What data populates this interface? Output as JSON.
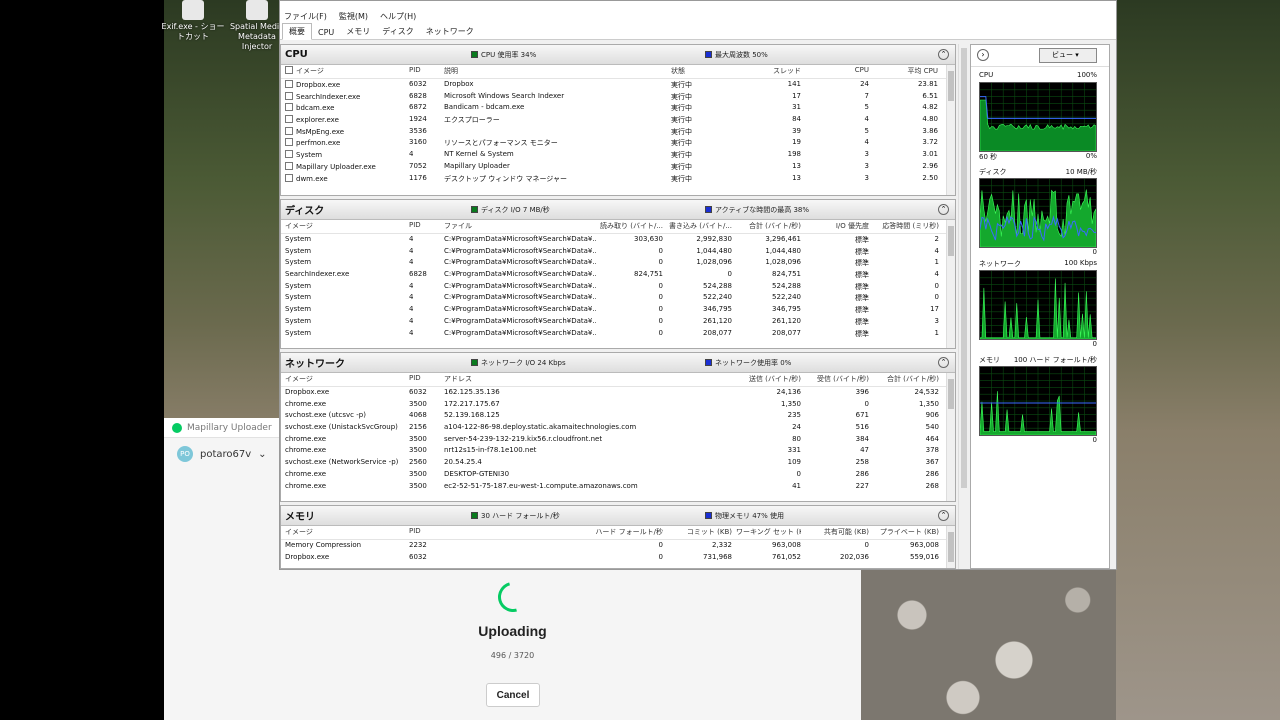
{
  "desktop": {
    "icons": [
      {
        "label": "Exif.exe - ショートカット"
      },
      {
        "label": "Spatial Media Metadata Injector"
      }
    ]
  },
  "mapillary": {
    "app_name": "Mapillary Uploader",
    "avatar_initials": "PO",
    "username": "potaro67v",
    "status": "Uploading",
    "progress": "496 / 3720",
    "cancel_label": "Cancel"
  },
  "monitor": {
    "menu": [
      "ファイル(F)",
      "監視(M)",
      "ヘルプ(H)"
    ],
    "tabs": [
      "概要",
      "CPU",
      "メモリ",
      "ディスク",
      "ネットワーク"
    ],
    "cpu": {
      "title": "CPU",
      "ind1": "CPU 使用率 34%",
      "ind2": "最大周波数 50%",
      "headers": [
        "イメージ",
        "PID",
        "説明",
        "状態",
        "スレッド",
        "CPU",
        "平均 CPU"
      ],
      "rows": [
        [
          "Dropbox.exe",
          "6032",
          "Dropbox",
          "実行中",
          "141",
          "24",
          "23.81"
        ],
        [
          "SearchIndexer.exe",
          "6828",
          "Microsoft Windows Search Indexer",
          "実行中",
          "17",
          "7",
          "6.51"
        ],
        [
          "bdcam.exe",
          "6872",
          "Bandicam - bdcam.exe",
          "実行中",
          "31",
          "5",
          "4.82"
        ],
        [
          "explorer.exe",
          "1924",
          "エクスプローラー",
          "実行中",
          "84",
          "4",
          "4.80"
        ],
        [
          "MsMpEng.exe",
          "3536",
          "",
          "実行中",
          "39",
          "5",
          "3.86"
        ],
        [
          "perfmon.exe",
          "3160",
          "リソースとパフォーマンス モニター",
          "実行中",
          "19",
          "4",
          "3.72"
        ],
        [
          "System",
          "4",
          "NT Kernel & System",
          "実行中",
          "198",
          "3",
          "3.01"
        ],
        [
          "Mapillary Uploader.exe",
          "7052",
          "Mapillary Uploader",
          "実行中",
          "13",
          "3",
          "2.96"
        ],
        [
          "dwm.exe",
          "1176",
          "デスクトップ ウィンドウ マネージャー",
          "実行中",
          "13",
          "3",
          "2.50"
        ]
      ]
    },
    "disk": {
      "title": "ディスク",
      "ind1": "ディスク I/O 7 MB/秒",
      "ind2": "アクティブな時間の最高 38%",
      "headers": [
        "イメージ",
        "PID",
        "ファイル",
        "読み取り (バイト/...",
        "書き込み (バイト/...",
        "合計 (バイト/秒)",
        "I/O 優先度",
        "応答時間 (ミリ秒)"
      ],
      "rows": [
        [
          "System",
          "4",
          "C:¥ProgramData¥Microsoft¥Search¥Data¥...",
          "303,630",
          "2,992,830",
          "3,296,461",
          "標準",
          "2"
        ],
        [
          "System",
          "4",
          "C:¥ProgramData¥Microsoft¥Search¥Data¥...",
          "0",
          "1,044,480",
          "1,044,480",
          "標準",
          "4"
        ],
        [
          "System",
          "4",
          "C:¥ProgramData¥Microsoft¥Search¥Data¥...",
          "0",
          "1,028,096",
          "1,028,096",
          "標準",
          "1"
        ],
        [
          "SearchIndexer.exe",
          "6828",
          "C:¥ProgramData¥Microsoft¥Search¥Data¥...",
          "824,751",
          "0",
          "824,751",
          "標準",
          "4"
        ],
        [
          "System",
          "4",
          "C:¥ProgramData¥Microsoft¥Search¥Data¥...",
          "0",
          "524,288",
          "524,288",
          "標準",
          "0"
        ],
        [
          "System",
          "4",
          "C:¥ProgramData¥Microsoft¥Search¥Data¥...",
          "0",
          "522,240",
          "522,240",
          "標準",
          "0"
        ],
        [
          "System",
          "4",
          "C:¥ProgramData¥Microsoft¥Search¥Data¥...",
          "0",
          "346,795",
          "346,795",
          "標準",
          "17"
        ],
        [
          "System",
          "4",
          "C:¥ProgramData¥Microsoft¥Search¥Data¥...",
          "0",
          "261,120",
          "261,120",
          "標準",
          "3"
        ],
        [
          "System",
          "4",
          "C:¥ProgramData¥Microsoft¥Search¥Data¥...",
          "0",
          "208,077",
          "208,077",
          "標準",
          "1"
        ]
      ]
    },
    "network": {
      "title": "ネットワーク",
      "ind1": "ネットワーク I/O 24 Kbps",
      "ind2": "ネットワーク使用率 0%",
      "headers": [
        "イメージ",
        "PID",
        "アドレス",
        "送信 (バイト/秒)",
        "受信 (バイト/秒)",
        "合計 (バイト/秒)"
      ],
      "rows": [
        [
          "Dropbox.exe",
          "6032",
          "162.125.35.136",
          "24,136",
          "396",
          "24,532"
        ],
        [
          "chrome.exe",
          "3500",
          "172.217.175.67",
          "1,350",
          "0",
          "1,350"
        ],
        [
          "svchost.exe (utcsvc -p)",
          "4068",
          "52.139.168.125",
          "235",
          "671",
          "906"
        ],
        [
          "svchost.exe (UnistackSvcGroup)",
          "2156",
          "a104-122-86-98.deploy.static.akamaitechnologies.com",
          "24",
          "516",
          "540"
        ],
        [
          "chrome.exe",
          "3500",
          "server-54-239-132-219.kix56.r.cloudfront.net",
          "80",
          "384",
          "464"
        ],
        [
          "chrome.exe",
          "3500",
          "nrt12s15-in-f78.1e100.net",
          "331",
          "47",
          "378"
        ],
        [
          "svchost.exe (NetworkService -p)",
          "2560",
          "20.54.25.4",
          "109",
          "258",
          "367"
        ],
        [
          "chrome.exe",
          "3500",
          "DESKTOP-GTENI30",
          "0",
          "286",
          "286"
        ],
        [
          "chrome.exe",
          "3500",
          "ec2-52-51-75-187.eu-west-1.compute.amazonaws.com",
          "41",
          "227",
          "268"
        ]
      ]
    },
    "memory": {
      "title": "メモリ",
      "ind1": "30 ハード フォールト/秒",
      "ind2": "物理メモリ 47% 使用",
      "headers": [
        "イメージ",
        "PID",
        "ハード フォールト/秒",
        "コミット (KB)",
        "ワーキング セット (KB)",
        "共有可能 (KB)",
        "プライベート (KB)"
      ],
      "rows": [
        [
          "Memory Compression",
          "2232",
          "0",
          "2,332",
          "963,008",
          "0",
          "963,008"
        ],
        [
          "Dropbox.exe",
          "6032",
          "0",
          "731,968",
          "761,052",
          "202,036",
          "559,016"
        ]
      ]
    },
    "side": {
      "view_label": "ビュー",
      "graphs": [
        {
          "name": "CPU",
          "max": "100%",
          "foot_left": "60 秒",
          "foot_right": "0%"
        },
        {
          "name": "ディスク",
          "max": "10 MB/秒",
          "foot_left": "",
          "foot_right": "0"
        },
        {
          "name": "ネットワーク",
          "max": "100 Kbps",
          "foot_left": "",
          "foot_right": "0"
        },
        {
          "name": "メモリ",
          "max": "100 ハード フォールト/秒",
          "foot_left": "",
          "foot_right": "0"
        }
      ]
    }
  }
}
